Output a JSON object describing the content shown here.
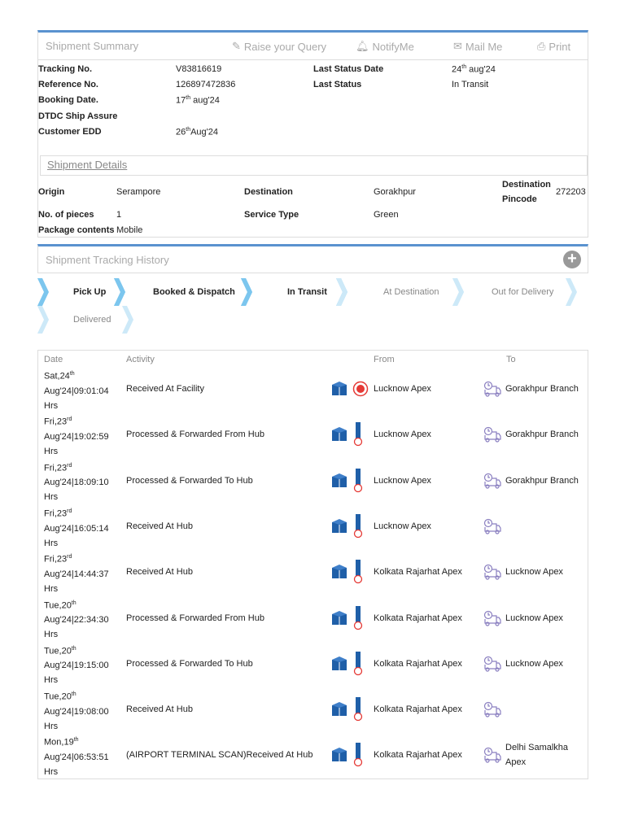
{
  "summary": {
    "title": "Shipment Summary",
    "actions": {
      "query": "Raise your Query",
      "notify": "NotifyMe",
      "mail": "Mail Me",
      "print": "Print"
    },
    "tracking_label": "Tracking No.",
    "tracking": "V83816619",
    "reference_label": "Reference No.",
    "reference": "126897472836",
    "booking_label": "Booking Date.",
    "booking_day": "17",
    "booking_sup": "th",
    "booking_rest": " aug'24",
    "assure_label": "DTDC Ship Assure",
    "edd_label": "Customer EDD",
    "edd_day": "26",
    "edd_sup": "th",
    "edd_rest": "Aug'24",
    "last_date_label": "Last Status Date",
    "last_date_day": "24",
    "last_date_sup": "th",
    "last_date_rest": " aug'24",
    "last_status_label": "Last Status",
    "last_status": "In Transit"
  },
  "details": {
    "title": "Shipment Details",
    "origin_label": "Origin",
    "origin": "Serampore",
    "dest_label": "Destination",
    "dest": "Gorakhpur",
    "pincode_label1": "Destination",
    "pincode_label2": "Pincode",
    "pincode": "272203",
    "pieces_label": "No. of pieces",
    "pieces": "1",
    "service_label": "Service Type",
    "service": "Green",
    "contents_label": "Package contents",
    "contents": "Mobile"
  },
  "history": {
    "title": "Shipment Tracking History",
    "steps": [
      {
        "label": "Pick Up",
        "done": true
      },
      {
        "label": "Booked & Dispatch",
        "done": true
      },
      {
        "label": "In Transit",
        "done": true
      },
      {
        "label": "At Destination",
        "done": false
      },
      {
        "label": "Out for Delivery",
        "done": false
      },
      {
        "label": "Delivered",
        "done": false
      }
    ]
  },
  "table": {
    "headers": {
      "date": "Date",
      "activity": "Activity",
      "from": "From",
      "to": "To"
    },
    "rows": [
      {
        "d1": "Sat,24",
        "sup": "th",
        "d2": "Aug'24|09:01:04",
        "d3": "Hrs",
        "activity": "Received At Facility",
        "from": "Lucknow Apex",
        "to": "Gorakhpur Branch",
        "current": true
      },
      {
        "d1": "Fri,23",
        "sup": "rd",
        "d2": "Aug'24|19:02:59",
        "d3": "Hrs",
        "activity": "Processed & Forwarded From Hub",
        "from": "Lucknow Apex",
        "to": "Gorakhpur Branch"
      },
      {
        "d1": "Fri,23",
        "sup": "rd",
        "d2": "Aug'24|18:09:10",
        "d3": "Hrs",
        "activity": "Processed & Forwarded To Hub",
        "from": "Lucknow Apex",
        "to": "Gorakhpur Branch"
      },
      {
        "d1": "Fri,23",
        "sup": "rd",
        "d2": "Aug'24|16:05:14",
        "d3": "Hrs",
        "activity": "Received At Hub",
        "from": "Lucknow Apex",
        "to": ""
      },
      {
        "d1": "Fri,23",
        "sup": "rd",
        "d2": "Aug'24|14:44:37",
        "d3": "Hrs",
        "activity": "Received At Hub",
        "from": "Kolkata Rajarhat Apex",
        "to": "Lucknow Apex"
      },
      {
        "d1": "Tue,20",
        "sup": "th",
        "d2": "Aug'24|22:34:30",
        "d3": "Hrs",
        "activity": "Processed & Forwarded From Hub",
        "from": "Kolkata Rajarhat Apex",
        "to": "Lucknow Apex"
      },
      {
        "d1": "Tue,20",
        "sup": "th",
        "d2": "Aug'24|19:15:00",
        "d3": "Hrs",
        "activity": "Processed & Forwarded To Hub",
        "from": "Kolkata Rajarhat Apex",
        "to": "Lucknow Apex"
      },
      {
        "d1": "Tue,20",
        "sup": "th",
        "d2": "Aug'24|19:08:00",
        "d3": "Hrs",
        "activity": "Received At Hub",
        "from": "Kolkata Rajarhat Apex",
        "to": ""
      },
      {
        "d1": "Mon,19",
        "sup": "th",
        "d2": "Aug'24|06:53:51",
        "d3": "Hrs",
        "activity": "(AIRPORT TERMINAL SCAN)Received At Hub",
        "from": "Kolkata Rajarhat Apex",
        "to": "Delhi Samalkha Apex"
      }
    ]
  },
  "colors": {
    "accent": "#5a92cf",
    "box_icon": "#1f5fa8",
    "marker": "#e53935",
    "truck": "#8a7fc0"
  }
}
